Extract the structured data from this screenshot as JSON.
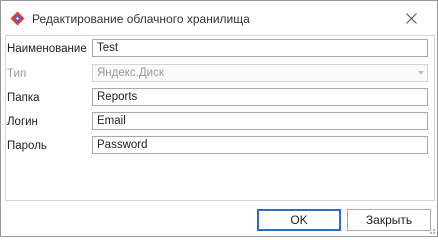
{
  "window": {
    "title": "Редактирование облачного хранилища"
  },
  "form": {
    "name": {
      "label": "Наименование",
      "value": "Test"
    },
    "type": {
      "label": "Тип",
      "value": "Яндекс.Диск"
    },
    "folder": {
      "label": "Папка",
      "value": "Reports"
    },
    "login": {
      "label": "Логин",
      "value": "Email"
    },
    "password": {
      "label": "Пароль",
      "value": "Password"
    }
  },
  "buttons": {
    "ok": "OK",
    "close": "Закрыть"
  },
  "colors": {
    "accent": "#2b6fc3",
    "icon_red": "#e03b3b",
    "icon_blue": "#2f6fd6"
  }
}
